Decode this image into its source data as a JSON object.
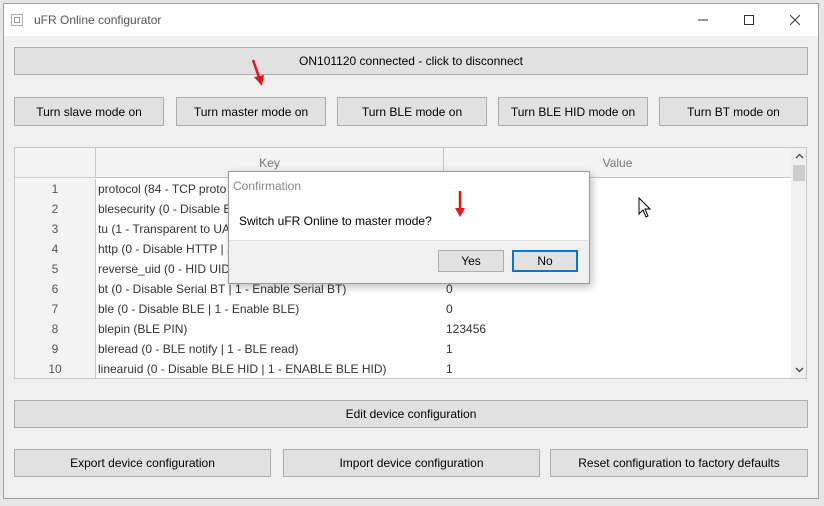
{
  "window": {
    "title": "uFR Online configurator",
    "minimize_glyph": "—",
    "maximize_glyph": "☐",
    "close_glyph": "✕"
  },
  "connection_button": "ON101120 connected - click to disconnect",
  "mode_buttons": {
    "slave": "Turn slave mode on",
    "master": "Turn master mode on",
    "ble": "Turn BLE mode on",
    "ble_hid": "Turn BLE HID mode on",
    "bt": "Turn BT mode on"
  },
  "table": {
    "headers": {
      "key": "Key",
      "value": "Value"
    },
    "rows": [
      {
        "num": "1",
        "key": "protocol (84 - TCP proto",
        "value": ""
      },
      {
        "num": "2",
        "key": "blesecurity (0 - Disable B",
        "value": ""
      },
      {
        "num": "3",
        "key": "tu (1 - Transparent to UA",
        "value": ""
      },
      {
        "num": "4",
        "key": "http (0 - Disable HTTP | 1",
        "value": ""
      },
      {
        "num": "5",
        "key": "reverse_uid (0 - HID UID",
        "value": ""
      },
      {
        "num": "6",
        "key": "bt (0 - Disable Serial BT | 1 - Enable Serial BT)",
        "value": "0"
      },
      {
        "num": "7",
        "key": "ble (0 - Disable BLE | 1 - Enable BLE)",
        "value": "0"
      },
      {
        "num": "8",
        "key": "blepin (BLE PIN)",
        "value": "123456"
      },
      {
        "num": "9",
        "key": "bleread (0 - BLE notify | 1 - BLE read)",
        "value": "1"
      },
      {
        "num": "10",
        "key": "linearuid (0 - Disable BLE HID | 1 - ENABLE BLE HID)",
        "value": "1"
      }
    ]
  },
  "actions": {
    "edit": "Edit device configuration",
    "export": "Export device configuration",
    "import": "Import device configuration",
    "reset": "Reset configuration to factory defaults"
  },
  "dialog": {
    "title": "Confirmation",
    "message": "Switch uFR Online to master mode?",
    "yes": "Yes",
    "no": "No"
  },
  "colors": {
    "annotation_arrow": "#e8141b",
    "focus_accent": "#0078d7"
  }
}
